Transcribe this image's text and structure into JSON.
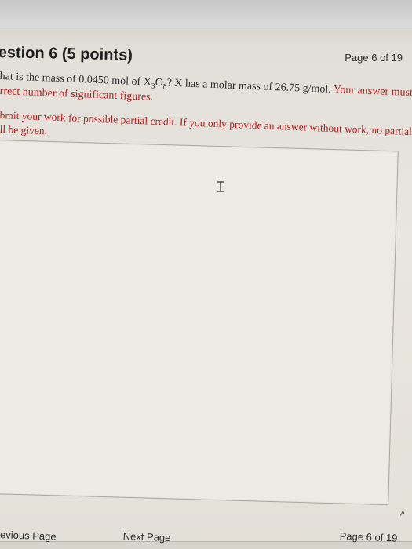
{
  "header": {
    "page_indicator": "Page 6 of 19"
  },
  "question": {
    "title": "estion 6 (5 points)",
    "line1_prefix": "hat is the mass of 0.0450 mol of X",
    "x_sub": "3",
    "o_label": "O",
    "o_sub": "8",
    "line1_suffix": "?  X has a molar mass of 26.75 g/mol.",
    "line1_req": " Your answer must have the",
    "line2": "rrect number of significant figures.",
    "line3": "bmit your work for possible partial credit.  If you only provide an answer without work, no partial credit",
    "line4": "ll be given."
  },
  "answer": {
    "cursor": "I-beam cursor"
  },
  "footer": {
    "previous": "revious Page",
    "next": "Next Page",
    "page_indicator": "Page 6 of 19",
    "scroll_glyph": "⩘"
  },
  "icons": {
    "ibeam": "i-beam-cursor-icon"
  },
  "colors": {
    "required_text": "#c01a1a",
    "body_text": "#2a2a2a",
    "background": "#e9e6df"
  }
}
